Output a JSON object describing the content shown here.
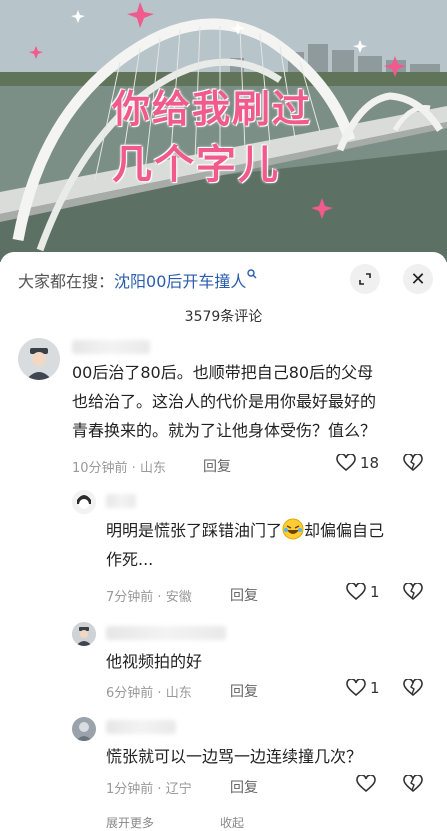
{
  "video": {
    "overlay_line1": "你给我刷过",
    "overlay_line2": "几个字儿"
  },
  "panel": {
    "search_prefix": "大家都在搜：",
    "search_query": "沈阳00后开车撞人",
    "comment_count": "3579条评论",
    "close_label": "✕"
  },
  "comments": [
    {
      "text": "00后治了80后。也顺带把自己80后的父母也给治了。这治人的代价是用你最好最好的青春换来的。就为了让他身体受伤？值么？",
      "lines": [
        "00后治了80后。也顺带把自己80后的父母",
        "也给治了。这治人的代价是用你最好最好的",
        "青春换来的。就为了让他身体受伤？值么？"
      ],
      "time": "10分钟前",
      "location": "山东",
      "reply": "回复",
      "likes": "18"
    },
    {
      "line1_before_emoji": "明明是慌张了踩错油门了",
      "line1_after_emoji": "却偏偏自己",
      "line2": "作死...",
      "time": "7分钟前",
      "location": "安徽",
      "reply": "回复",
      "likes": "1"
    },
    {
      "text": "他视频拍的好",
      "time": "6分钟前",
      "location": "山东",
      "reply": "回复",
      "likes": "1"
    },
    {
      "text": "慌张就可以一边骂一边连续撞几次？",
      "time": "1分钟前",
      "location": "辽宁",
      "reply": "回复",
      "likes": ""
    }
  ],
  "footer": {
    "expand": "展开更多",
    "collapse": "收起"
  },
  "colors": {
    "overlay_pink": "#f05a8d",
    "search_blue": "#2a5db0"
  }
}
